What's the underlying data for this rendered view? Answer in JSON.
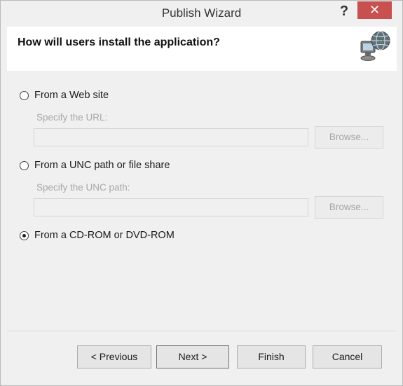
{
  "window": {
    "title": "Publish Wizard",
    "help_label": "?",
    "close_label": "✕"
  },
  "header": {
    "title": "How will users install the application?",
    "icon": "globe-computer-icon"
  },
  "options": {
    "web": {
      "label": "From a Web site",
      "sub_label": "Specify the URL:",
      "value": "",
      "browse_label": "Browse...",
      "selected": false
    },
    "unc": {
      "label": "From a UNC path or file share",
      "sub_label": "Specify the UNC path:",
      "value": "",
      "browse_label": "Browse...",
      "selected": false
    },
    "cd": {
      "label": "From a CD-ROM or DVD-ROM",
      "selected": true
    }
  },
  "footer": {
    "previous_label": "< Previous",
    "next_label": "Next >",
    "finish_label": "Finish",
    "cancel_label": "Cancel"
  }
}
